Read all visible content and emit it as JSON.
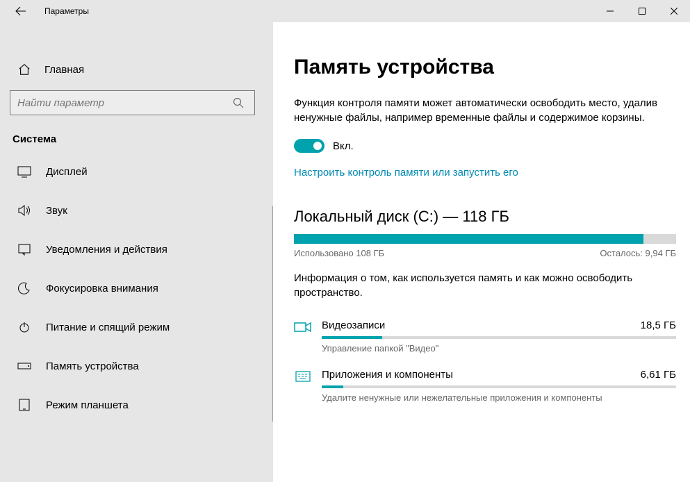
{
  "window": {
    "title": "Параметры"
  },
  "sidebar": {
    "home_label": "Главная",
    "search_placeholder": "Найти параметр",
    "section_label": "Система",
    "items": [
      {
        "label": "Дисплей"
      },
      {
        "label": "Звук"
      },
      {
        "label": "Уведомления и действия"
      },
      {
        "label": "Фокусировка внимания"
      },
      {
        "label": "Питание и спящий режим"
      },
      {
        "label": "Память устройства"
      },
      {
        "label": "Режим планшета"
      }
    ]
  },
  "main": {
    "title": "Память устройства",
    "description": "Функция контроля памяти может автоматически освободить место, удалив ненужные файлы, например временные файлы и содержимое корзины.",
    "toggle_label": "Вкл.",
    "config_link": "Настроить контроль памяти или запустить его",
    "storage": {
      "title": "Локальный диск (C:) — 118 ГБ",
      "used_label": "Использовано 108 ГБ",
      "free_label": "Осталось: 9,94 ГБ",
      "used_pct": 91.5
    },
    "storage_desc": "Информация о том, как используется память и как можно освободить пространство.",
    "categories": [
      {
        "name": "Видеозаписи",
        "size": "18,5 ГБ",
        "sub": "Управление папкой \"Видео\"",
        "pct": 17
      },
      {
        "name": "Приложения и компоненты",
        "size": "6,61 ГБ",
        "sub": "Удалите ненужные или нежелательные приложения и компоненты",
        "pct": 6
      }
    ]
  }
}
